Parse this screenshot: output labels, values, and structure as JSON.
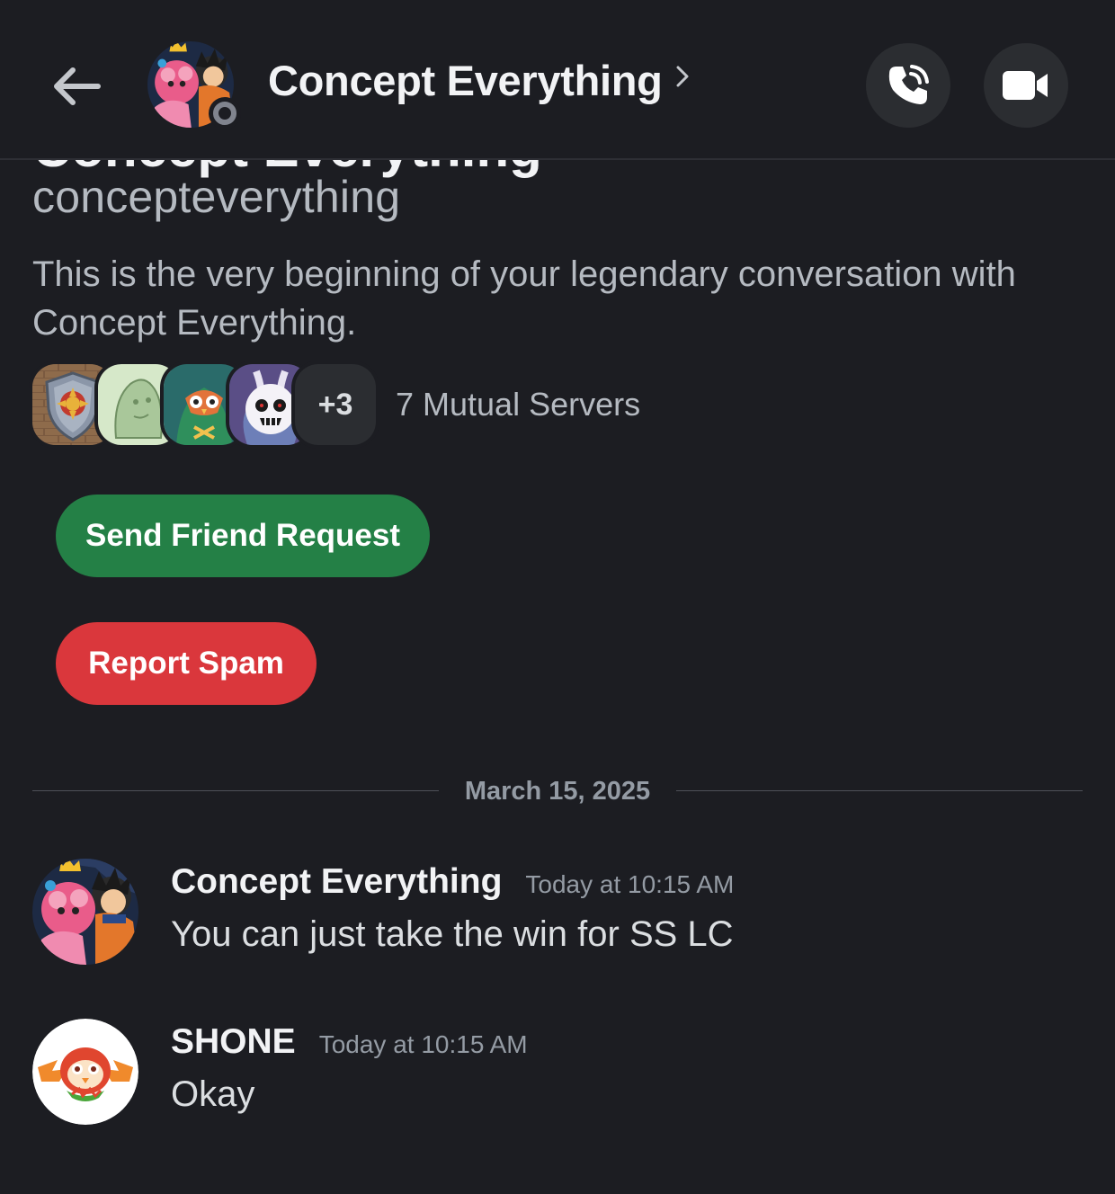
{
  "header": {
    "title": "Concept Everything",
    "back_icon": "arrow-left-icon",
    "chevron_icon": "chevron-right-icon",
    "call_icon": "phone-call-icon",
    "video_icon": "video-camera-icon",
    "status": "offline"
  },
  "intro": {
    "display_name": "Concept Everything",
    "username": "concepteverything",
    "description": "This is the very beginning of your legendary conversation with Concept Everything.",
    "mutual": {
      "more_count": "+3",
      "label": "7 Mutual Servers"
    }
  },
  "actions": {
    "friend_request_label": "Send Friend Request",
    "report_spam_label": "Report Spam"
  },
  "divider": {
    "date": "March 15, 2025"
  },
  "messages": [
    {
      "author": "Concept Everything",
      "time": "Today at 10:15 AM",
      "text": "You can just take the win for SS LC"
    },
    {
      "author": "SHONE",
      "time": "Today at 10:15 AM",
      "text": "Okay"
    }
  ],
  "colors": {
    "background": "#1c1d22",
    "header_button": "#2b2d31",
    "friend_green": "#248046",
    "spam_red": "#da373c",
    "muted_text": "#b5bac1",
    "timestamp": "#949ba4"
  }
}
